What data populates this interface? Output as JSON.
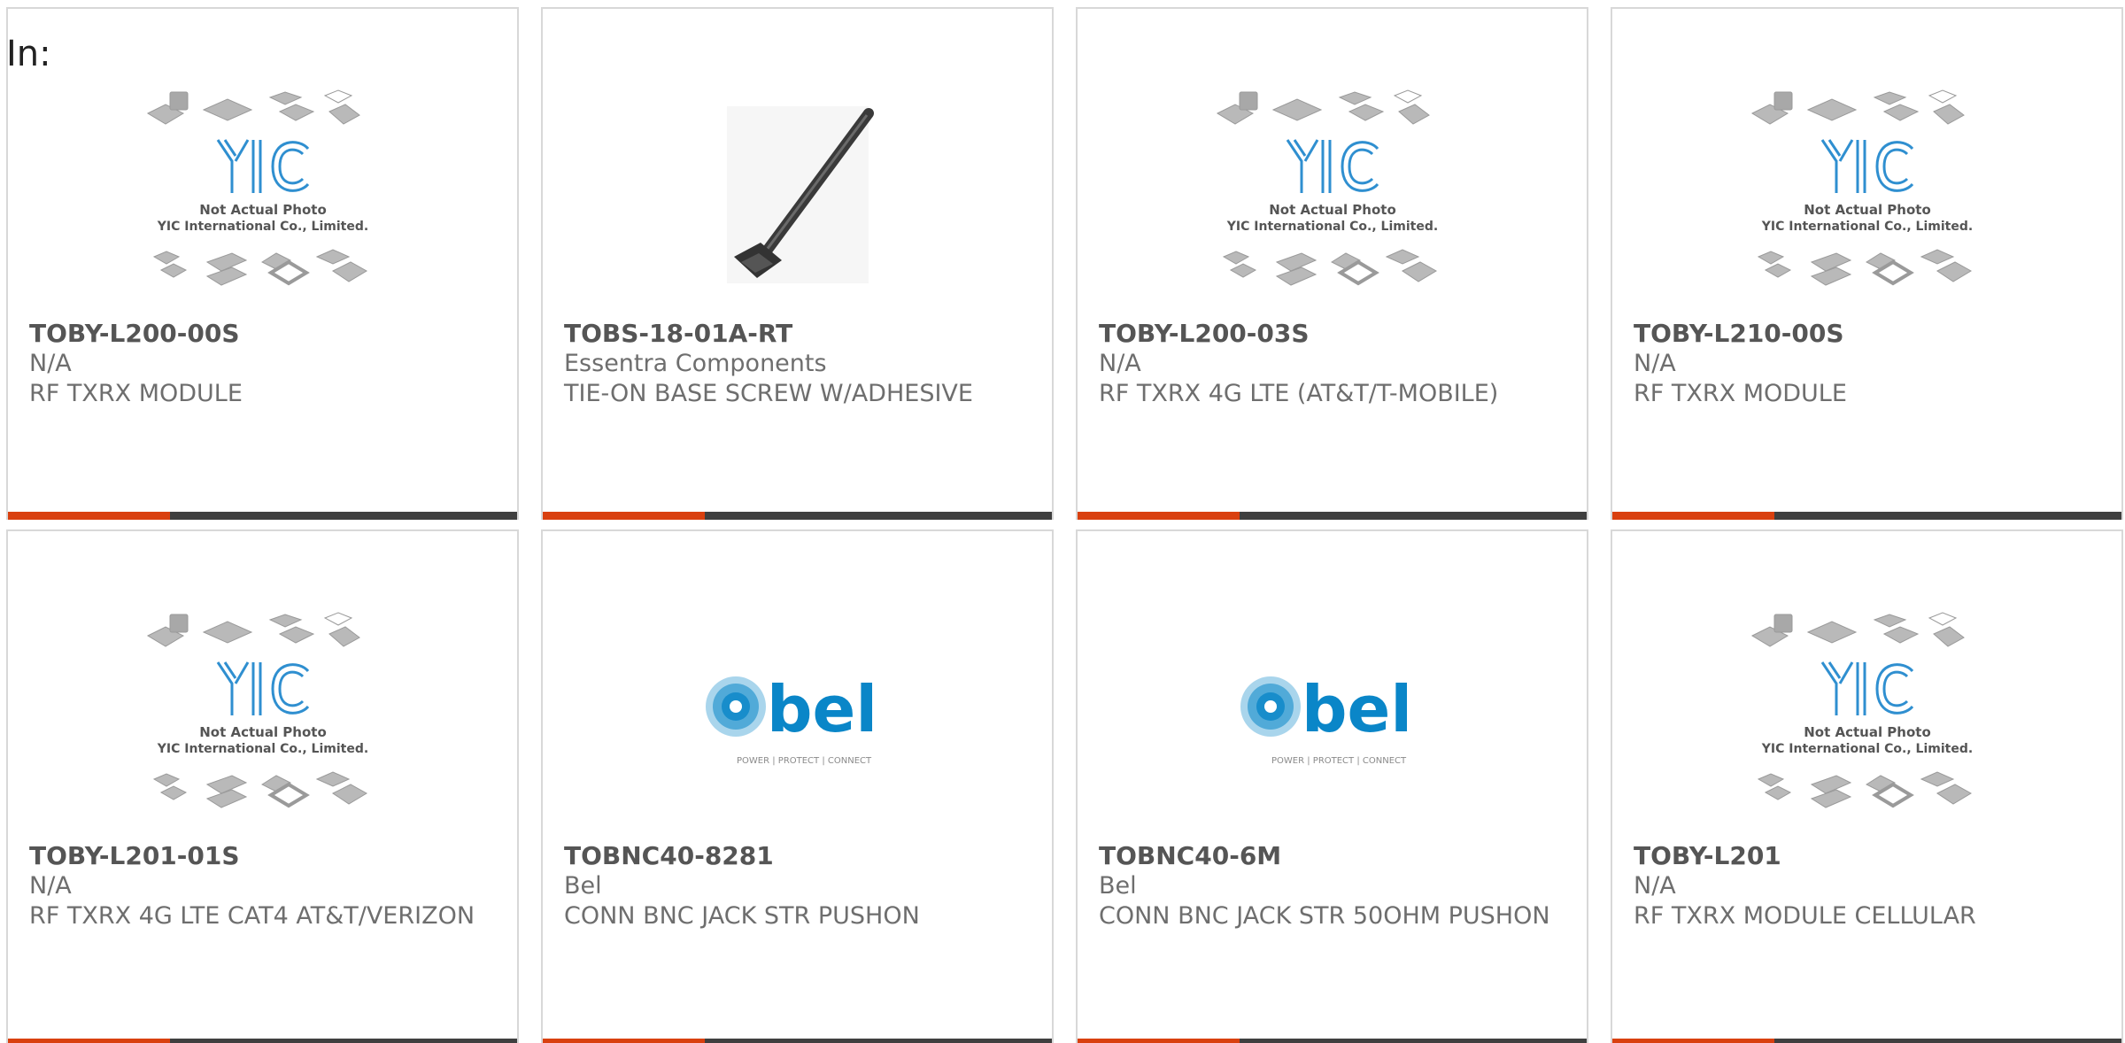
{
  "header": {
    "label": "In:"
  },
  "brand": {
    "accent": "#d9400f",
    "bar": "#3f3f3f",
    "yic_blue": "#2f8fd0",
    "bel_blue": "#0a86c8"
  },
  "placeholder": {
    "line1": "Not Actual Photo",
    "line2": "YIC International Co., Limited.",
    "logo": "YIC"
  },
  "bel_logo": {
    "word": "bel",
    "tagline": "POWER | PROTECT | CONNECT"
  },
  "products": [
    {
      "part": "TOBY-L200-00S",
      "mfr": "N/A",
      "desc": "RF TXRX MODULE",
      "image": "yic-placeholder"
    },
    {
      "part": "TOBS-18-01A-RT",
      "mfr": "Essentra Components",
      "desc": "TIE-ON BASE SCREW W/ADHESIVE",
      "image": "cable-tie-photo"
    },
    {
      "part": "TOBY-L200-03S",
      "mfr": "N/A",
      "desc": "RF TXRX 4G LTE (AT&T/T-MOBILE)",
      "image": "yic-placeholder"
    },
    {
      "part": "TOBY-L210-00S",
      "mfr": "N/A",
      "desc": "RF TXRX MODULE",
      "image": "yic-placeholder"
    },
    {
      "part": "TOBY-L201-01S",
      "mfr": "N/A",
      "desc": "RF TXRX 4G LTE CAT4 AT&T/VERIZON",
      "image": "yic-placeholder"
    },
    {
      "part": "TOBNC40-8281",
      "mfr": "Bel",
      "desc": "CONN BNC JACK STR PUSHON",
      "image": "bel-logo"
    },
    {
      "part": "TOBNC40-6M",
      "mfr": "Bel",
      "desc": "CONN BNC JACK STR 50OHM PUSHON",
      "image": "bel-logo"
    },
    {
      "part": "TOBY-L201",
      "mfr": "N/A",
      "desc": "RF TXRX MODULE CELLULAR",
      "image": "yic-placeholder"
    }
  ]
}
